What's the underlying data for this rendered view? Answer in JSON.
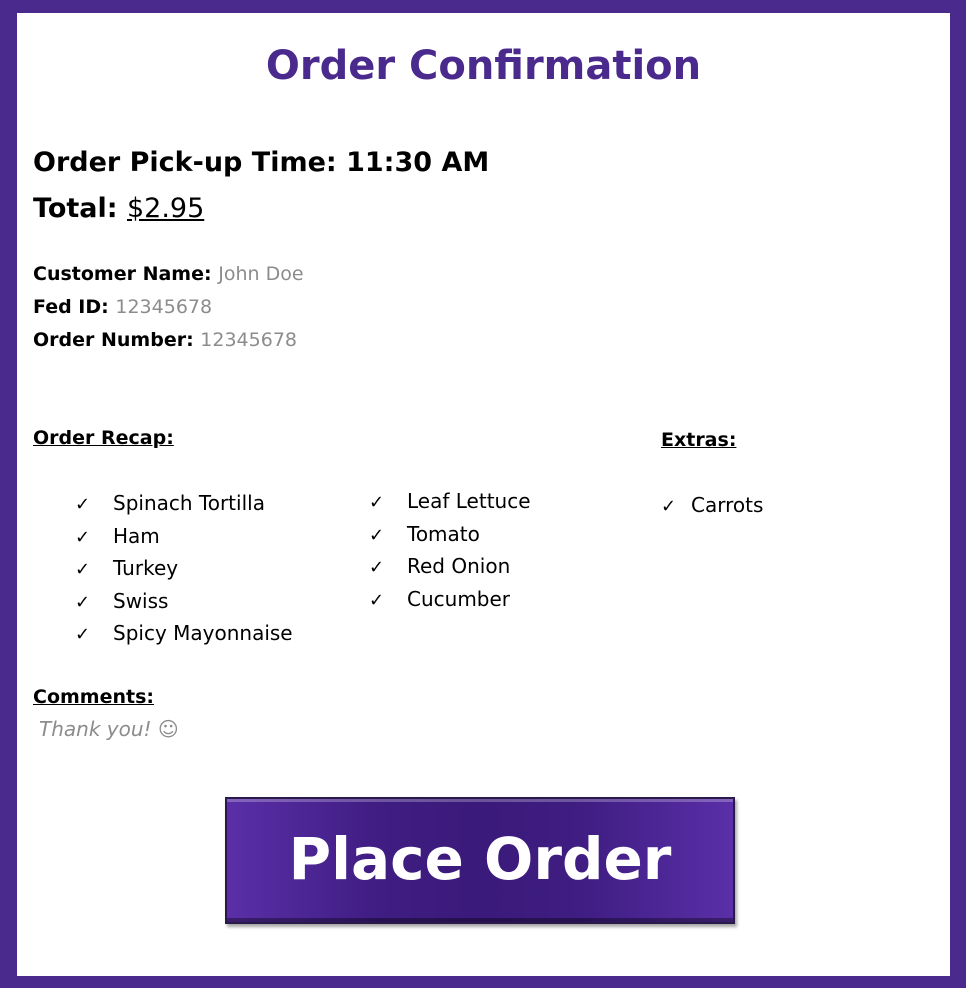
{
  "title": "Order Confirmation",
  "pickup": {
    "label": "Order Pick-up Time: ",
    "value": "11:30 AM"
  },
  "total": {
    "label": "Total: ",
    "value": "$2.95"
  },
  "customer": {
    "name_label": "Customer Name: ",
    "name_value": "John Doe",
    "fed_label": "Fed ID: ",
    "fed_value": "12345678",
    "order_label": "Order Number: ",
    "order_value": "12345678"
  },
  "recap": {
    "heading": "Order Recap:",
    "column1": [
      "Spinach Tortilla",
      "Ham",
      "Turkey",
      "Swiss",
      "Spicy Mayonnaise"
    ],
    "column2": [
      "Leaf Lettuce",
      "Tomato",
      "Red Onion",
      "Cucumber"
    ]
  },
  "extras": {
    "heading": "Extras:",
    "items": [
      "Carrots"
    ]
  },
  "comments": {
    "heading": "Comments:",
    "text": "Thank you! ☺"
  },
  "check_glyph": "✓",
  "place_order_label": "Place Order",
  "colors": {
    "accent": "#4a2a8c",
    "muted_text": "#8c8c8c"
  }
}
